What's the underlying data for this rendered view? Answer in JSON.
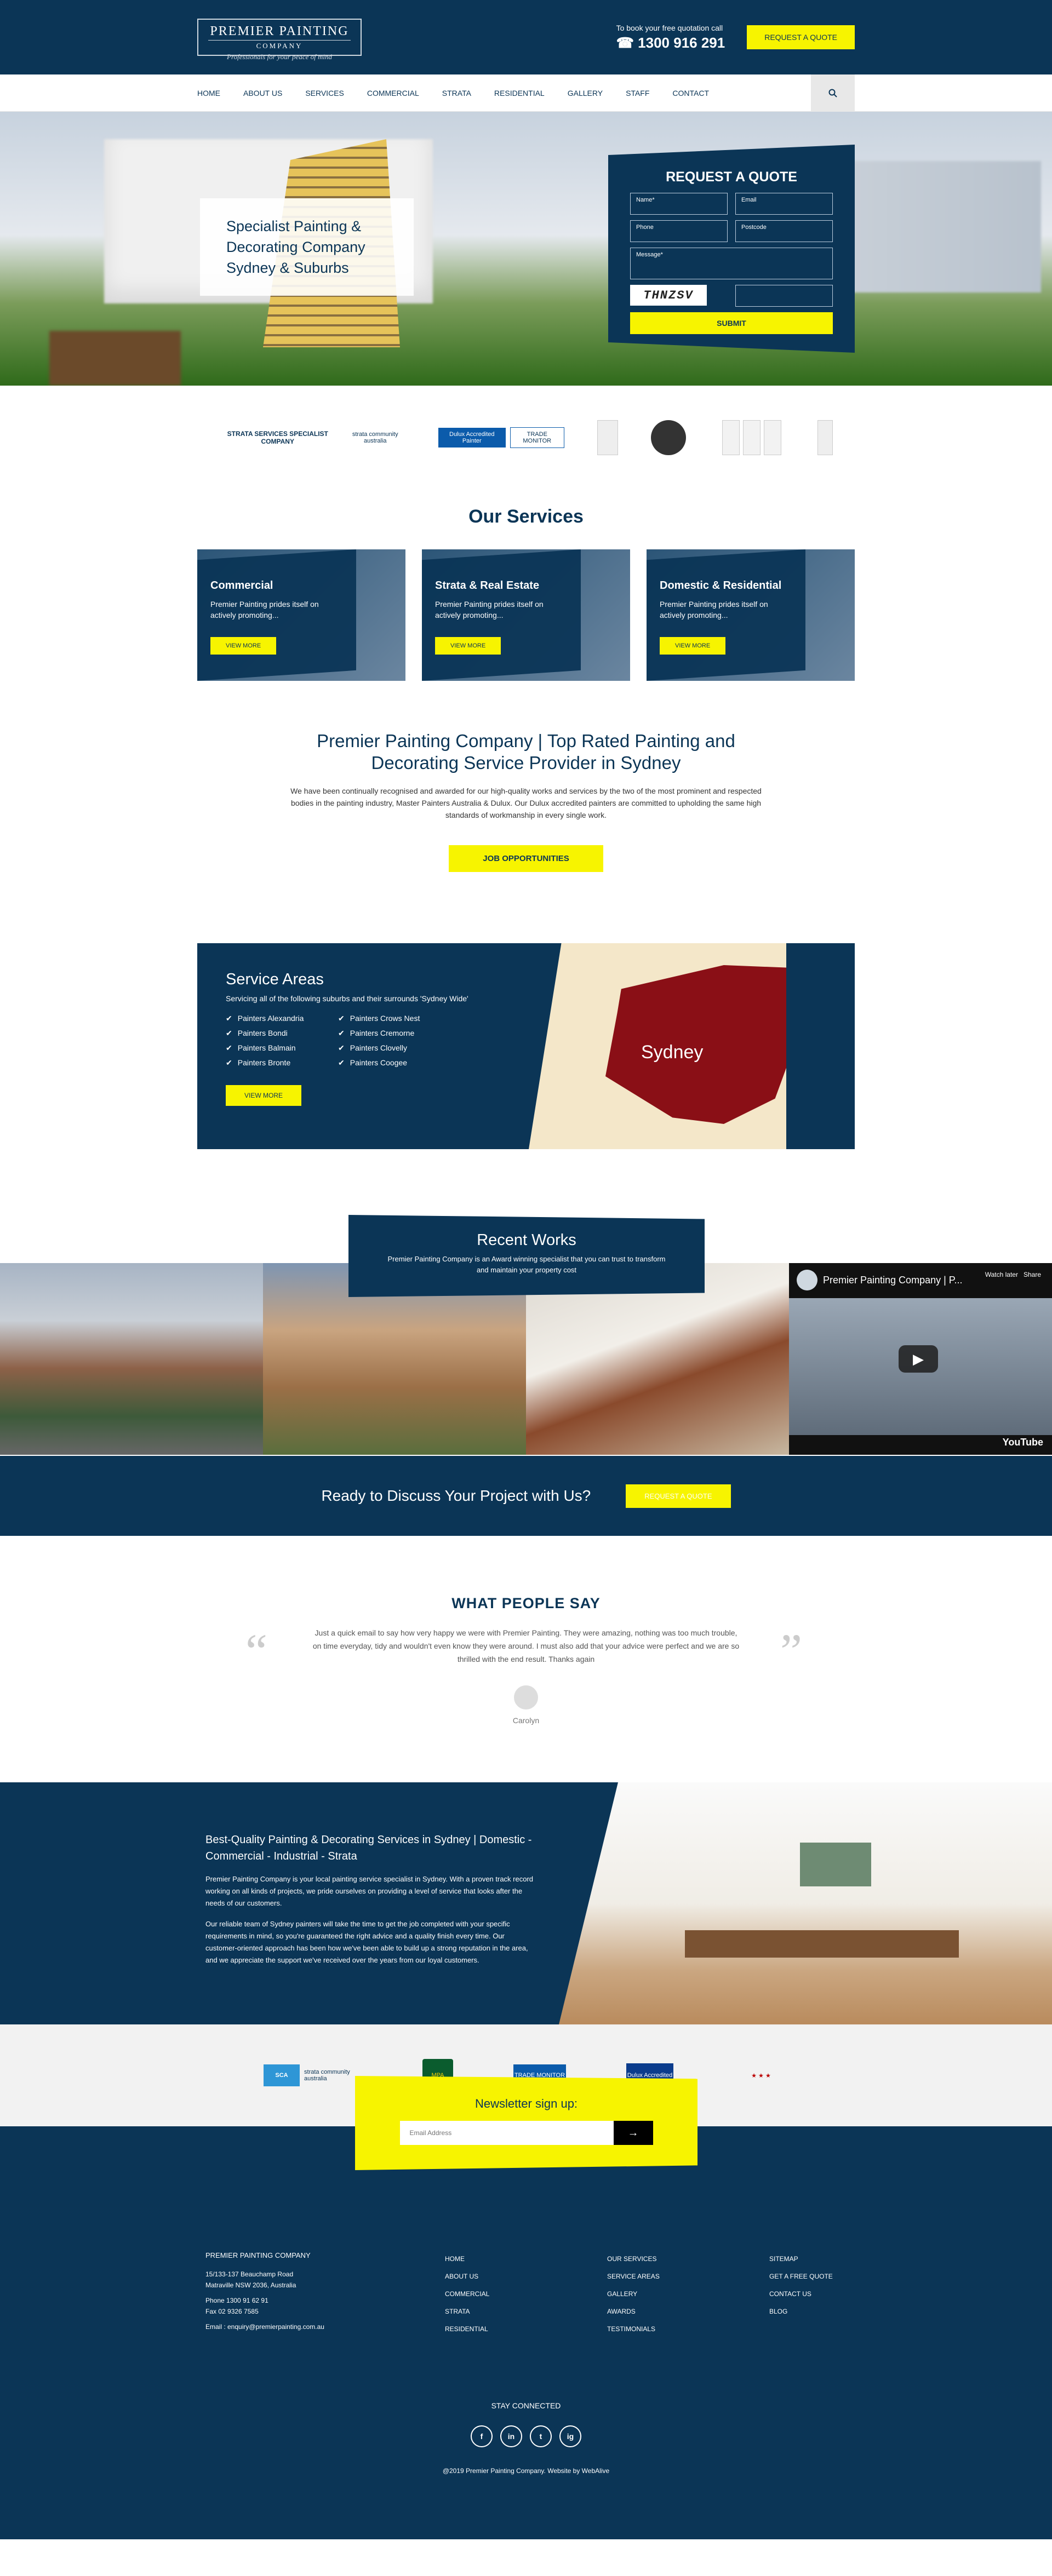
{
  "header": {
    "logo_line1": "PREMIER PAINTING",
    "logo_line2": "COMPANY",
    "tagline": "Professionals for your peace of mind",
    "call_text": "To book your free quotation call",
    "phone": "1300 916 291",
    "quote_button": "REQUEST A QUOTE"
  },
  "nav": {
    "items": [
      "HOME",
      "ABOUT US",
      "SERVICES",
      "COMMERCIAL",
      "STRATA",
      "RESIDENTIAL",
      "GALLERY",
      "STAFF",
      "CONTACT"
    ],
    "search_icon": "search-icon"
  },
  "hero": {
    "headline": "Specialist Painting & Decorating Company Sydney & Suburbs",
    "form": {
      "title": "REQUEST A QUOTE",
      "name": "Name*",
      "email": "Email",
      "phone": "Phone",
      "postcode": "Postcode",
      "message": "Message*",
      "captcha": "THNZSV",
      "submit": "SUBMIT"
    }
  },
  "badges": {
    "sqa_text": "STRATA SERVICES SPECIALIST COMPANY",
    "sca_text": "strata community australia",
    "dulux": "Dulux Accredited Painter",
    "tm": "TRADE MONITOR"
  },
  "services": {
    "title": "Our Services",
    "items": [
      {
        "title": "Commercial",
        "desc": "Premier Painting prides itself on actively promoting...",
        "btn": "VIEW MORE"
      },
      {
        "title": "Strata & Real Estate",
        "desc": "Premier Painting prides itself on actively promoting...",
        "btn": "VIEW MORE"
      },
      {
        "title": "Domestic & Residential",
        "desc": "Premier Painting prides itself on actively promoting...",
        "btn": "VIEW MORE"
      }
    ]
  },
  "intro": {
    "heading": "Premier Painting Company | Top Rated Painting and Decorating Service Provider in Sydney",
    "body": "We have been continually recognised and awarded for our high-quality works and services by the two of the most prominent and respected bodies in the painting industry, Master Painters Australia & Dulux. Our Dulux accredited painters are committed to upholding the same high standards of workmanship in every single work.",
    "button": "JOB OPPORTUNITIES"
  },
  "areas": {
    "title": "Service Areas",
    "subtitle": "Servicing all of the following suburbs and their surrounds 'Sydney Wide'",
    "list": [
      "Painters Alexandria",
      "Painters Crows Nest",
      "Painters Bondi",
      "Painters Cremorne",
      "Painters Balmain",
      "Painters Clovelly",
      "Painters Bronte",
      "Painters Coogee"
    ],
    "button": "VIEW MORE",
    "map_label": "Sydney"
  },
  "recent": {
    "title": "Recent Works",
    "desc": "Premier Painting Company is an Award winning specialist that you can trust to transform and maintain your property cost",
    "video_title": "Premier Painting Company | P...",
    "watch_later": "Watch later",
    "share": "Share",
    "youtube": "YouTube"
  },
  "cta": {
    "text": "Ready to Discuss Your Project with Us?",
    "button": "REQUEST A QUOTE"
  },
  "testimonial": {
    "title": "WHAT PEOPLE SAY",
    "text": "Just a quick email to say how very happy we were with Premier Painting. They were amazing, nothing was too much trouble, on time everyday, tidy and wouldn't even know they were around. I must also add that your advice were perfect and we are so thrilled with the end result. Thanks again",
    "name": "Carolyn",
    "open_quote": "“",
    "close_quote": "”"
  },
  "about": {
    "heading": "Best-Quality Painting & Decorating Services in Sydney | Domestic - Commercial - Industrial - Strata",
    "p1": "Premier Painting Company is your local painting service specialist in Sydney. With a proven track record working on all kinds of projects, we pride ourselves on providing a level of service that looks after the needs of our customers.",
    "p2": "Our reliable team of Sydney painters will take the time to get the job completed with your specific requirements in mind, so you're guaranteed the right advice and a quality finish every time. Our customer-oriented approach has been how we've been able to build up a strong reputation in the area, and we appreciate the support we've received over the years from our loyal customers."
  },
  "logos": {
    "sca": "strata community australia",
    "mpa": "MPA",
    "tm": "TRADE MONITOR",
    "dulux": "Dulux Accredited"
  },
  "newsletter": {
    "title": "Newsletter sign up:",
    "placeholder": "Email Address",
    "go": "→"
  },
  "footer": {
    "company": "PREMIER PAINTING COMPANY",
    "address1": "15/133-137 Beauchamp Road",
    "address2": "Matraville NSW 2036, Australia",
    "phone": "Phone 1300 91 62 91",
    "fax": "Fax 02 9326 7585",
    "email": "Email : enquiry@premierpainting.com.au",
    "col2": [
      "HOME",
      "ABOUT US",
      "COMMERCIAL",
      "STRATA",
      "RESIDENTIAL"
    ],
    "col3": [
      "OUR SERVICES",
      "SERVICE AREAS",
      "GALLERY",
      "AWARDS",
      "TESTIMONIALS"
    ],
    "col4": [
      "SITEMAP",
      "GET A FREE QUOTE",
      "CONTACT US",
      "BLOG"
    ],
    "stay": "STAY CONNECTED",
    "social": [
      "f",
      "in",
      "t",
      "ig"
    ],
    "copyright": "@2019 Premier Painting Company. Website by WebAlive"
  }
}
